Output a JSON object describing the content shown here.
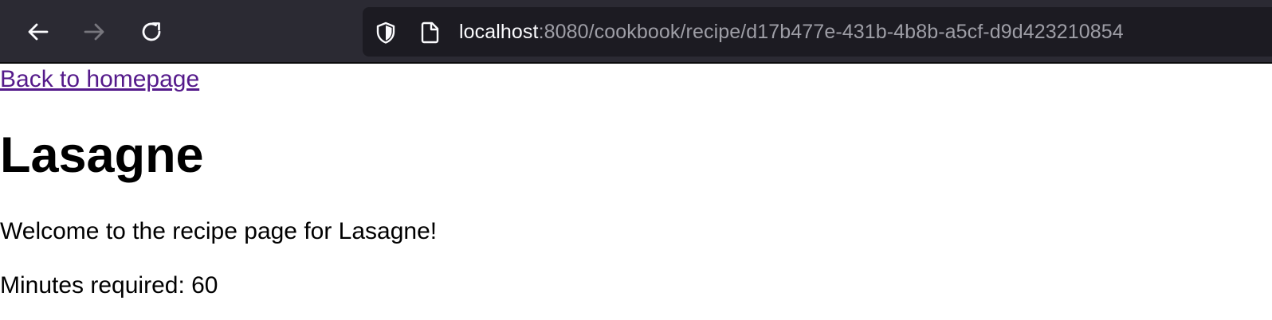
{
  "browser": {
    "nav": {
      "back_icon": "arrow-left-icon",
      "forward_icon": "arrow-right-icon",
      "reload_icon": "reload-icon",
      "forward_disabled": true
    },
    "urlbar": {
      "host": "localhost",
      "path": ":8080/cookbook/recipe/d17b477e-431b-4b8b-a5cf-d9d423210854",
      "security_icon": "shield-icon",
      "page_icon": "document-icon"
    },
    "colors": {
      "toolbar_bg": "#2b2a33",
      "urlbar_bg": "#1c1b22",
      "url_host": "#fbfbfe",
      "url_path": "#9e9ea6"
    }
  },
  "page": {
    "back_link": "Back to homepage",
    "title": "Lasagne",
    "welcome": "Welcome to the recipe page for Lasagne!",
    "minutes_label": "Minutes required: 60",
    "colors": {
      "link_visited": "#551a8b",
      "text": "#000000"
    }
  }
}
